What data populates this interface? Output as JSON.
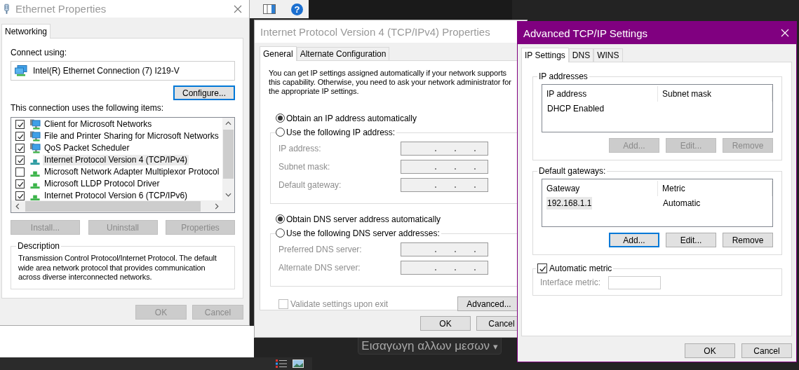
{
  "desktop": {
    "help_glyph": "?",
    "media_button": {
      "label": "Εισαγωγη αλλων μεσων",
      "caret": "▾"
    }
  },
  "ethernet_window": {
    "title": "Ethernet Properties",
    "active": false,
    "tabs": [
      {
        "label": "Networking",
        "selected": true
      }
    ],
    "connect_using_label": "Connect using:",
    "adapter": "Intel(R) Ethernet Connection (7) I219-V",
    "configure_button": {
      "label": "Configure...",
      "disabled": false,
      "focused": true
    },
    "items_label": "This connection uses the following items:",
    "items": [
      {
        "kind": "client",
        "label": "Client for Microsoft Networks",
        "checked": true,
        "selected": false
      },
      {
        "kind": "service",
        "label": "File and Printer Sharing for Microsoft Networks",
        "checked": true,
        "selected": false
      },
      {
        "kind": "service",
        "label": "QoS Packet Scheduler",
        "checked": true,
        "selected": false
      },
      {
        "kind": "protocol",
        "label": "Internet Protocol Version 4 (TCP/IPv4)",
        "checked": true,
        "selected": true
      },
      {
        "kind": "protocol",
        "label": "Microsoft Network Adapter Multiplexor Protocol",
        "checked": false,
        "selected": false
      },
      {
        "kind": "protocol",
        "label": "Microsoft LLDP Protocol Driver",
        "checked": true,
        "selected": false
      },
      {
        "kind": "protocol",
        "label": "Internet Protocol Version 6 (TCP/IPv6)",
        "checked": true,
        "selected": false
      }
    ],
    "item_buttons": [
      {
        "label": "Install...",
        "disabled": true,
        "focused": false
      },
      {
        "label": "Uninstall",
        "disabled": true,
        "focused": false
      },
      {
        "label": "Properties",
        "disabled": true,
        "focused": false
      }
    ],
    "description": {
      "title": "Description",
      "text": "Transmission Control Protocol/Internet Protocol. The default wide area network protocol that provides communication across diverse interconnected networks."
    },
    "footer_buttons": [
      {
        "label": "OK",
        "disabled": true,
        "focused": false
      },
      {
        "label": "Cancel",
        "disabled": true,
        "focused": false
      }
    ]
  },
  "ipv4_window": {
    "title": "Internet Protocol Version 4 (TCP/IPv4) Properties",
    "active": false,
    "tabs": [
      {
        "label": "General",
        "selected": true
      },
      {
        "label": "Alternate Configuration",
        "selected": false
      }
    ],
    "intro": "You can get IP settings assigned automatically if your network supports this capability. Otherwise, you need to ask your network administrator for the appropriate IP settings.",
    "ip_options": [
      {
        "label": "Obtain an IP address automatically",
        "selected": true
      },
      {
        "label": "Use the following IP address:",
        "selected": false
      }
    ],
    "ip_fields": [
      {
        "label": "IP address:",
        "disabled": true
      },
      {
        "label": "Subnet mask:",
        "disabled": true
      },
      {
        "label": "Default gateway:",
        "disabled": true
      }
    ],
    "dns_options": [
      {
        "label": "Obtain DNS server address automatically",
        "selected": true
      },
      {
        "label": "Use the following DNS server addresses:",
        "selected": false
      }
    ],
    "dns_fields": [
      {
        "label": "Preferred DNS server:",
        "disabled": true
      },
      {
        "label": "Alternate DNS server:",
        "disabled": true
      }
    ],
    "validate": {
      "label": "Validate settings upon exit",
      "checked": false,
      "disabled": true
    },
    "advanced_button": {
      "label": "Advanced...",
      "disabled": false,
      "focused": false
    },
    "footer_buttons": [
      {
        "label": "OK",
        "disabled": false,
        "focused": false
      },
      {
        "label": "Cancel",
        "disabled": false,
        "focused": false
      }
    ]
  },
  "advanced_window": {
    "title": "Advanced TCP/IP Settings",
    "active": true,
    "tabs": [
      {
        "label": "IP Settings",
        "selected": true
      },
      {
        "label": "DNS",
        "selected": false
      },
      {
        "label": "WINS",
        "selected": false
      }
    ],
    "groups": [
      {
        "title": "IP addresses",
        "columns": [
          "IP address",
          "Subnet mask"
        ],
        "rows": [
          {
            "cells": [
              "DHCP Enabled"
            ],
            "selected": false
          }
        ],
        "buttons": [
          {
            "label": "Add...",
            "disabled": true,
            "focused": false
          },
          {
            "label": "Edit...",
            "disabled": true,
            "focused": false
          },
          {
            "label": "Remove",
            "disabled": true,
            "focused": false
          }
        ]
      },
      {
        "title": "Default gateways:",
        "columns": [
          "Gateway",
          "Metric"
        ],
        "rows": [
          {
            "cells": [
              "192.168.1.1",
              "Automatic"
            ],
            "selected": true
          }
        ],
        "buttons": [
          {
            "label": "Add...",
            "disabled": false,
            "focused": true
          },
          {
            "label": "Edit...",
            "disabled": false,
            "focused": false
          },
          {
            "label": "Remove",
            "disabled": false,
            "focused": false
          }
        ]
      }
    ],
    "metric": {
      "label": "Automatic metric",
      "checked": true,
      "field_label": "Interface metric:",
      "field_disabled": true
    },
    "footer_buttons": [
      {
        "label": "OK",
        "disabled": false,
        "focused": false
      },
      {
        "label": "Cancel",
        "disabled": false,
        "focused": false
      }
    ]
  }
}
